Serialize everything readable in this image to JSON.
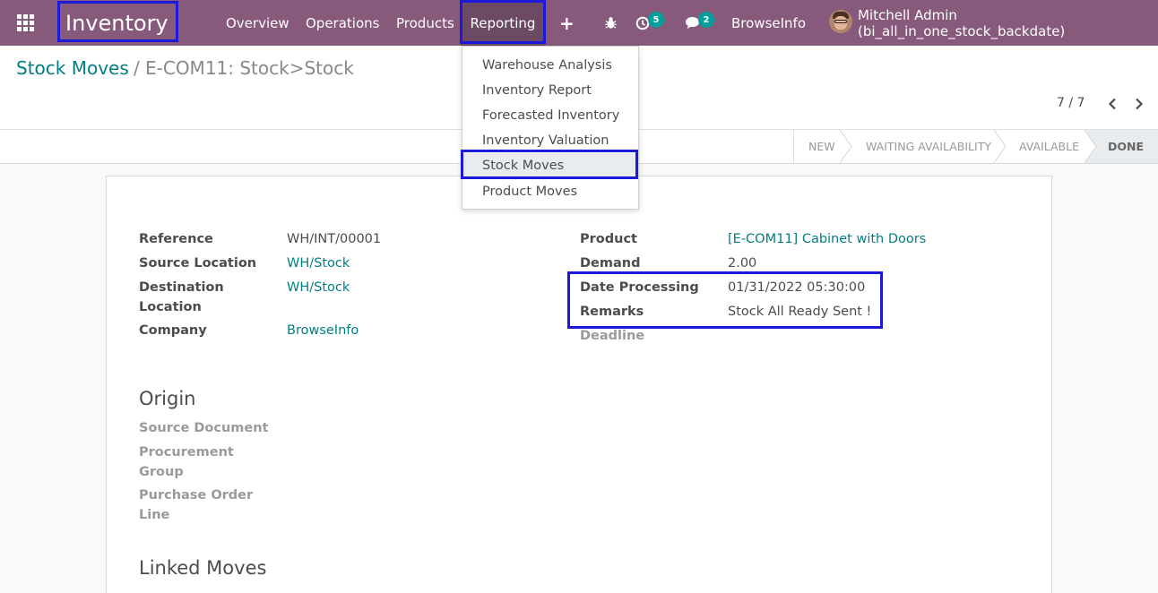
{
  "navbar": {
    "brand": "Inventory",
    "menu": [
      "Overview",
      "Operations",
      "Products",
      "Reporting"
    ],
    "activity_count": "5",
    "message_count": "2",
    "company": "BrowseInfo",
    "user": "Mitchell Admin (bi_all_in_one_stock_backdate)",
    "colors": {
      "bar": "#875a7b",
      "badge": "#01a09d"
    }
  },
  "dropdown": {
    "items": [
      "Warehouse Analysis",
      "Inventory Report",
      "Forecasted Inventory",
      "Inventory Valuation",
      "Stock Moves",
      "Product Moves"
    ],
    "active_item": "Stock Moves"
  },
  "breadcrumb": {
    "parent": "Stock Moves",
    "separator": "/",
    "current": "E-COM11: Stock>Stock"
  },
  "pager": {
    "value": "7 / 7"
  },
  "status": {
    "stages": [
      "NEW",
      "WAITING AVAILABILITY",
      "AVAILABLE",
      "DONE"
    ],
    "current": "DONE"
  },
  "form": {
    "left": [
      {
        "label": "Reference",
        "value": "WH/INT/00001"
      },
      {
        "label": "Source Location",
        "value": "WH/Stock"
      },
      {
        "label": "Destination Location",
        "value": "WH/Stock"
      },
      {
        "label": "Company",
        "value": "BrowseInfo"
      }
    ],
    "right": [
      {
        "label": "Product",
        "value": "[E-COM11] Cabinet with Doors"
      },
      {
        "label": "Demand",
        "value": "2.00"
      },
      {
        "label": "Date Processing",
        "value": "01/31/2022 05:30:00"
      },
      {
        "label": "Remarks",
        "value": "Stock All Ready Sent !"
      },
      {
        "label": "Deadline",
        "value": ""
      }
    ],
    "origin": {
      "title": "Origin",
      "fields": [
        "Source Document",
        "Procurement Group",
        "Purchase Order Line"
      ]
    },
    "linked_title": "Linked Moves"
  }
}
